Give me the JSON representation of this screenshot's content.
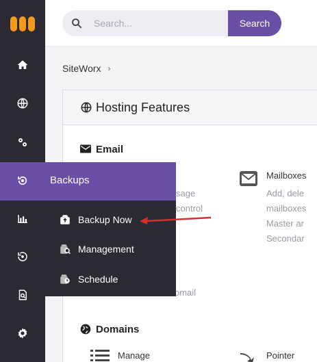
{
  "search": {
    "placeholder": "Search...",
    "button_label": "Search"
  },
  "breadcrumb": {
    "item": "SiteWorx",
    "separator": "›"
  },
  "panel": {
    "title": "Hosting Features"
  },
  "sections": {
    "email": {
      "title": "Email",
      "mailboxes_label": "Mailboxes",
      "mailboxes_desc": [
        "Add, dele",
        "mailboxes",
        "Master ar",
        "Secondar"
      ],
      "left_desc": [
        "sage",
        "control"
      ],
      "trailing_text": "omail"
    },
    "domains": {
      "title": "Domains",
      "manage_label": "Manage",
      "pointer_label": "Pointer"
    }
  },
  "flyout": {
    "title": "Backups",
    "items": [
      {
        "label": "Backup Now"
      },
      {
        "label": "Management"
      },
      {
        "label": "Schedule"
      }
    ]
  },
  "colors": {
    "accent": "#6a4fa7",
    "sidebar": "#2b2a33",
    "logo": "#f39a1e",
    "arrow": "#d32f2f"
  }
}
